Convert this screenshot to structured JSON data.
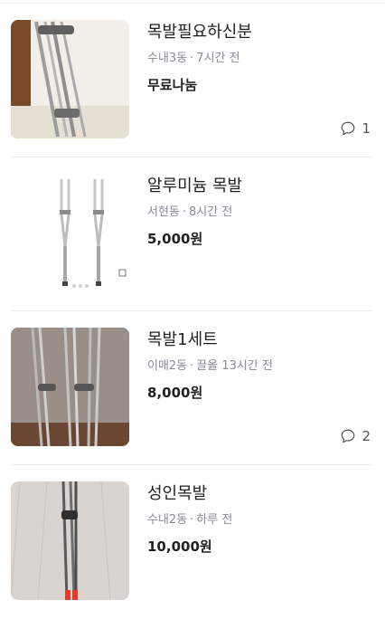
{
  "items": [
    {
      "title": "목발필요하신분",
      "location": "수내3동",
      "time": "7시간 전",
      "price": "무료나눔",
      "chat_count": "1",
      "thumb": "crutch-photo-light"
    },
    {
      "title": "알루미늄 목발",
      "location": "서현동",
      "time": "8시간 전",
      "price": "5,000원",
      "chat_count": "",
      "thumb": "crutch-product-white"
    },
    {
      "title": "목발1세트",
      "location": "이매2동",
      "time": "끌올 13시간 전",
      "price": "8,000원",
      "chat_count": "2",
      "thumb": "crutch-photo-dark"
    },
    {
      "title": "성인목발",
      "location": "수내2동",
      "time": "하루 전",
      "price": "10,000원",
      "chat_count": "",
      "thumb": "crutch-photo-floor"
    }
  ],
  "icons": {
    "chat": "chat-bubble-icon"
  },
  "colors": {
    "meta": "#868b94",
    "divider": "#eaebee",
    "text": "#212124"
  }
}
